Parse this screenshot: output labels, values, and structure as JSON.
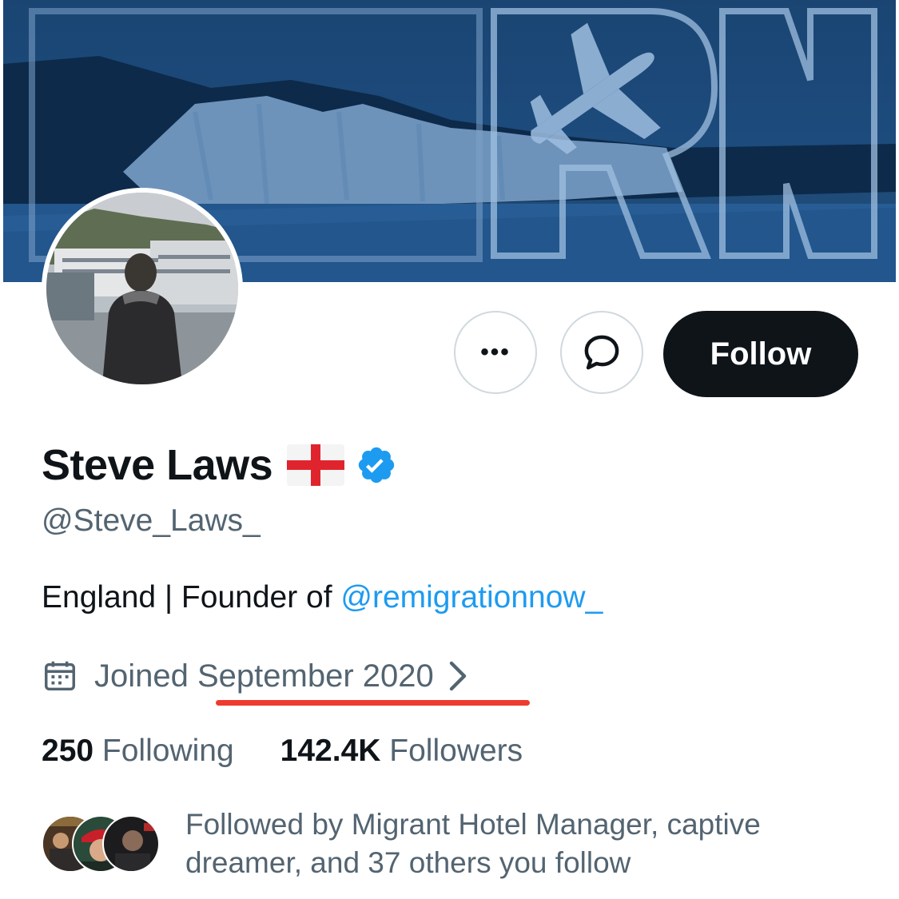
{
  "banner": {
    "logo_text": "RN"
  },
  "actions": {
    "more_label": "•••",
    "follow_label": "Follow"
  },
  "profile": {
    "name": "Steve Laws",
    "handle": "@Steve_Laws_",
    "bio_prefix": "England | Founder of ",
    "bio_link": "@remigrationnow_",
    "joined": "Joined September 2020"
  },
  "stats": {
    "following_count": "250",
    "following_label": "Following",
    "followers_count": "142.4K",
    "followers_label": "Followers"
  },
  "followed_by": {
    "text": "Followed by Migrant Hotel Manager, captive dreamer, and 37 others you follow"
  },
  "icons": {
    "more": "more-icon",
    "message": "message-icon",
    "verified": "verified-badge-icon",
    "flag": "england-flag-icon",
    "calendar": "calendar-icon",
    "chevron": "chevron-right-icon"
  },
  "colors": {
    "accent": "#1d9bf0",
    "banner": "#1d4a78",
    "button_dark": "#0f1419",
    "secondary_text": "#536471",
    "annotation_underline": "#ef3b2f"
  }
}
